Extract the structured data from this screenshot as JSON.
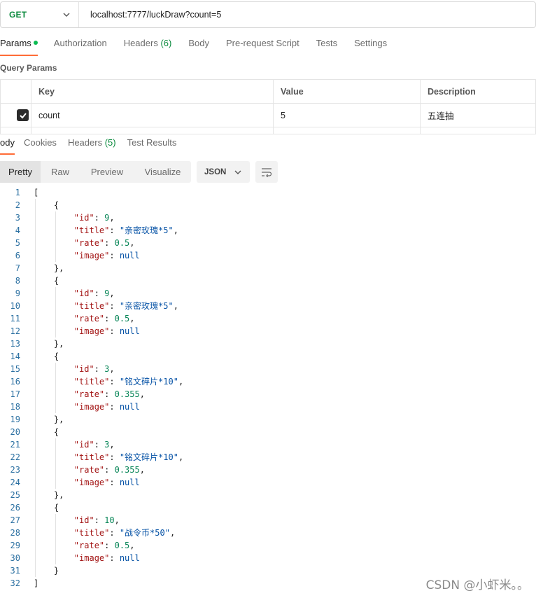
{
  "request": {
    "method": "GET",
    "url": "localhost:7777/luckDraw?count=5"
  },
  "request_tabs": [
    {
      "label": "Params",
      "active": true,
      "dot": true
    },
    {
      "label": "Authorization"
    },
    {
      "label": "Headers",
      "count": "(6)"
    },
    {
      "label": "Body"
    },
    {
      "label": "Pre-request Script"
    },
    {
      "label": "Tests"
    },
    {
      "label": "Settings"
    }
  ],
  "query_params": {
    "title": "Query Params",
    "headers": {
      "key": "Key",
      "value": "Value",
      "description": "Description"
    },
    "rows": [
      {
        "checked": true,
        "key": "count",
        "value": "5",
        "description": "五连抽"
      }
    ]
  },
  "response_tabs": [
    {
      "label": "ody",
      "active": true
    },
    {
      "label": "Cookies"
    },
    {
      "label": "Headers",
      "count": "(5)"
    },
    {
      "label": "Test Results"
    }
  ],
  "view_modes": [
    "Pretty",
    "Raw",
    "Preview",
    "Visualize"
  ],
  "active_view": "Pretty",
  "format": "JSON",
  "response_items": [
    {
      "id": 9,
      "title": "亲密玫瑰*5",
      "rate": "0.5",
      "image": "null"
    },
    {
      "id": 9,
      "title": "亲密玫瑰*5",
      "rate": "0.5",
      "image": "null"
    },
    {
      "id": 3,
      "title": "铭文碎片*10",
      "rate": "0.355",
      "image": "null"
    },
    {
      "id": 3,
      "title": "铭文碎片*10",
      "rate": "0.355",
      "image": "null"
    },
    {
      "id": 10,
      "title": "战令币*50",
      "rate": "0.5",
      "image": "null"
    }
  ],
  "watermark": "CSDN @小虾米。。",
  "colors": {
    "accent": "#ff6c37",
    "get_method": "#0b8a3e",
    "json_key": "#a31515",
    "json_string": "#0451a5",
    "json_number": "#098658"
  },
  "icons": [
    "chevron-down-icon",
    "checkbox-checked-icon",
    "wrap-lines-icon"
  ]
}
